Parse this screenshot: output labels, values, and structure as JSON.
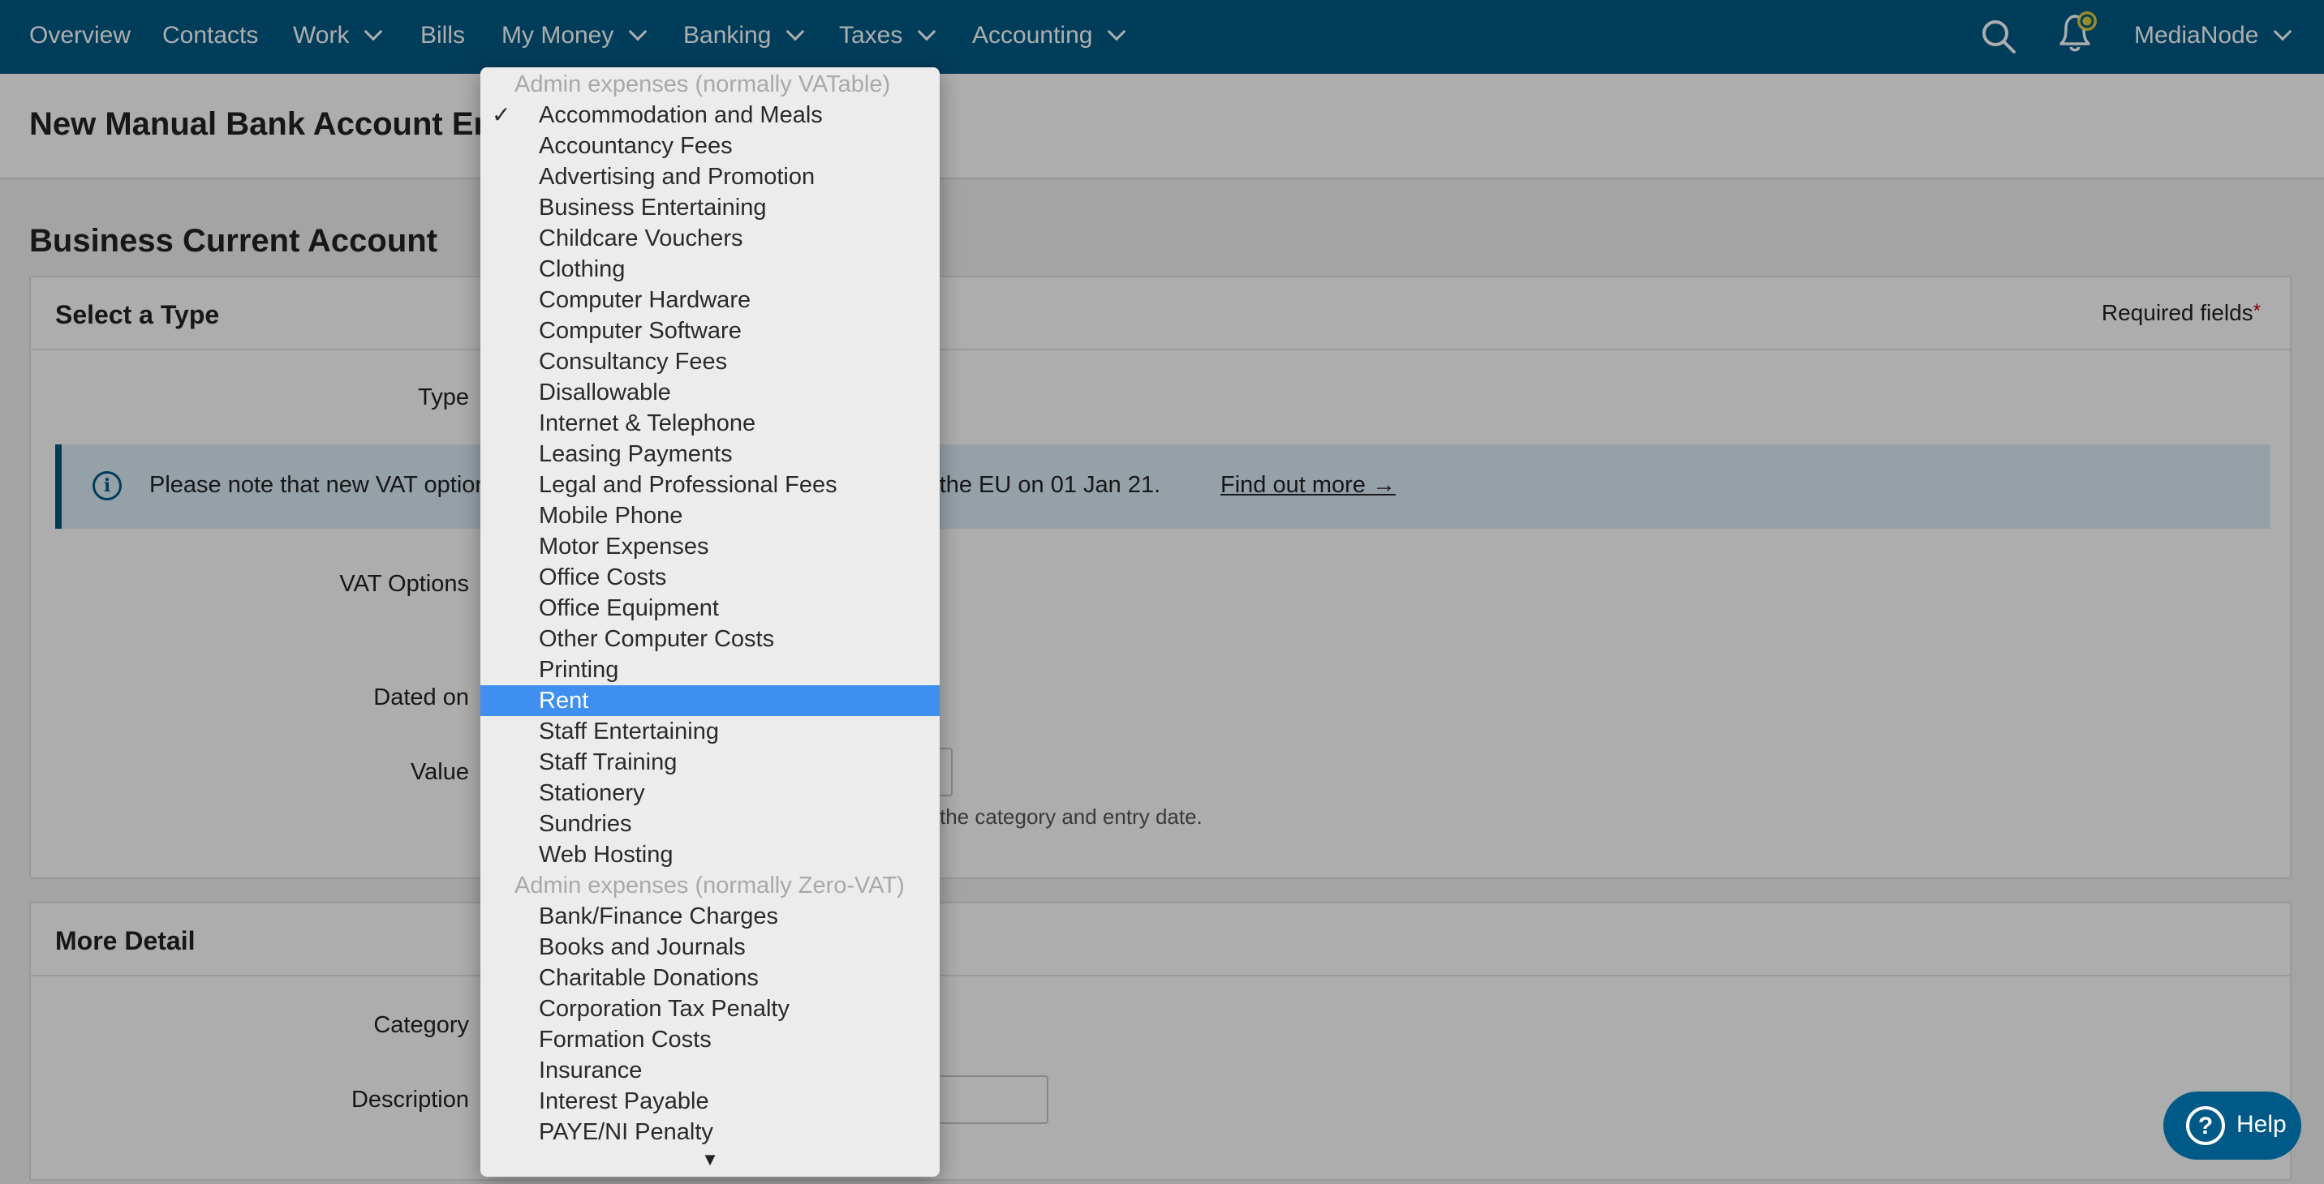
{
  "nav": {
    "items": [
      {
        "label": "Overview",
        "dropdown": false
      },
      {
        "label": "Contacts",
        "dropdown": false
      },
      {
        "label": "Work",
        "dropdown": true
      },
      {
        "label": "Bills",
        "dropdown": false
      },
      {
        "label": "My Money",
        "dropdown": true
      },
      {
        "label": "Banking",
        "dropdown": true
      },
      {
        "label": "Taxes",
        "dropdown": true
      },
      {
        "label": "Accounting",
        "dropdown": true
      }
    ],
    "user": "MediaNode",
    "icons": {
      "search": "search-icon",
      "notifications": "bell-icon"
    }
  },
  "page": {
    "title": "New Manual Bank Account Entry",
    "account_title": "Business Current Account"
  },
  "type_panel": {
    "heading": "Select a Type",
    "required_label": "Required fields",
    "required_star": "*",
    "type_label": "Type",
    "info_text": "Please note that new VAT options are available for transactions to and from the EU on 01 Jan 21.",
    "info_link": "Find out more →",
    "vat_label": "VAT Options",
    "dated_label": "Dated on",
    "value_label": "Value",
    "hint": "the category and entry date."
  },
  "detail_panel": {
    "heading": "More Detail",
    "category_label": "Category",
    "description_label": "Description"
  },
  "help": {
    "label": "Help"
  },
  "dropdown": {
    "options": [
      {
        "label": "Admin expenses (normally VATable)",
        "kind": "group"
      },
      {
        "label": "Accommodation and Meals",
        "kind": "option",
        "checked": true
      },
      {
        "label": "Accountancy Fees",
        "kind": "option"
      },
      {
        "label": "Advertising and Promotion",
        "kind": "option"
      },
      {
        "label": "Business Entertaining",
        "kind": "option"
      },
      {
        "label": "Childcare Vouchers",
        "kind": "option"
      },
      {
        "label": "Clothing",
        "kind": "option"
      },
      {
        "label": "Computer Hardware",
        "kind": "option"
      },
      {
        "label": "Computer Software",
        "kind": "option"
      },
      {
        "label": "Consultancy Fees",
        "kind": "option"
      },
      {
        "label": "Disallowable",
        "kind": "option"
      },
      {
        "label": "Internet & Telephone",
        "kind": "option"
      },
      {
        "label": "Leasing Payments",
        "kind": "option"
      },
      {
        "label": "Legal and Professional Fees",
        "kind": "option"
      },
      {
        "label": "Mobile Phone",
        "kind": "option"
      },
      {
        "label": "Motor Expenses",
        "kind": "option"
      },
      {
        "label": "Office Costs",
        "kind": "option"
      },
      {
        "label": "Office Equipment",
        "kind": "option"
      },
      {
        "label": "Other Computer Costs",
        "kind": "option"
      },
      {
        "label": "Printing",
        "kind": "option"
      },
      {
        "label": "Rent",
        "kind": "option",
        "highlighted": true
      },
      {
        "label": "Staff Entertaining",
        "kind": "option"
      },
      {
        "label": "Staff Training",
        "kind": "option"
      },
      {
        "label": "Stationery",
        "kind": "option"
      },
      {
        "label": "Sundries",
        "kind": "option"
      },
      {
        "label": "Web Hosting",
        "kind": "option"
      },
      {
        "label": "Admin expenses (normally Zero-VAT)",
        "kind": "group"
      },
      {
        "label": "Bank/Finance Charges",
        "kind": "option"
      },
      {
        "label": "Books and Journals",
        "kind": "option"
      },
      {
        "label": "Charitable Donations",
        "kind": "option"
      },
      {
        "label": "Corporation Tax Penalty",
        "kind": "option"
      },
      {
        "label": "Formation Costs",
        "kind": "option"
      },
      {
        "label": "Insurance",
        "kind": "option"
      },
      {
        "label": "Interest Payable",
        "kind": "option"
      },
      {
        "label": "PAYE/NI Penalty",
        "kind": "option"
      }
    ],
    "check_mark": "✓",
    "more_arrow": "▼"
  },
  "colors": {
    "brand": "#005a87",
    "highlight": "#3e8ff0"
  }
}
